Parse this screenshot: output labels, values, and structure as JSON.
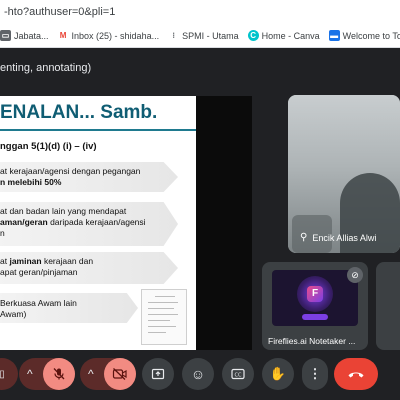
{
  "browser": {
    "url": "-hto?authuser=0&pli=1",
    "bookmarks": [
      {
        "label": "Jabata...",
        "icon": "folder-icon",
        "color": "#5f6368"
      },
      {
        "label": "Inbox (25) - shidaha...",
        "icon": "gmail-icon",
        "color": "#ea4335"
      },
      {
        "label": "SPMI - Utama",
        "icon": "bookmark-icon",
        "color": "#5f6368"
      },
      {
        "label": "Home - Canva",
        "icon": "canva-icon",
        "color": "#00c4cc"
      },
      {
        "label": "Welcome to Touch '...",
        "icon": "touch-icon",
        "color": "#1a73e8"
      }
    ]
  },
  "meeting": {
    "presenting_title": "enting, annotating)"
  },
  "slide": {
    "title": "ENALAN... Samb.",
    "subtitle": "nggan 5(1)(d) (i) – (iv)",
    "bullets": [
      {
        "line1": "at kerajaan/agensi dengan pegangan",
        "line2_bold": "n melebihi 50%",
        "line2": ""
      },
      {
        "line1": "at dan badan lain yang mendapat",
        "line2_bold": "aman/geran",
        "line2": " daripada kerajaan/agensi",
        "line3": "n"
      },
      {
        "line1_prefix": "at ",
        "line1_bold": "jaminan",
        "line1": " kerajaan dan",
        "line2": "apat geran/pinjaman"
      },
      {
        "line1": "Berkuasa Awam lain",
        "line2": "Awam)"
      }
    ]
  },
  "participants": [
    {
      "name": "Encik Allias Alwi",
      "pinned": true
    },
    {
      "name": "Fireflies.ai Notetaker ...",
      "muted": true
    }
  ],
  "controls": {
    "mic": "mic-off",
    "camera": "camera-off"
  },
  "colors": {
    "meet_bg": "#202124",
    "slide_title": "#0f5d73",
    "end_call": "#ea4335",
    "muted_red": "#f28b82"
  }
}
